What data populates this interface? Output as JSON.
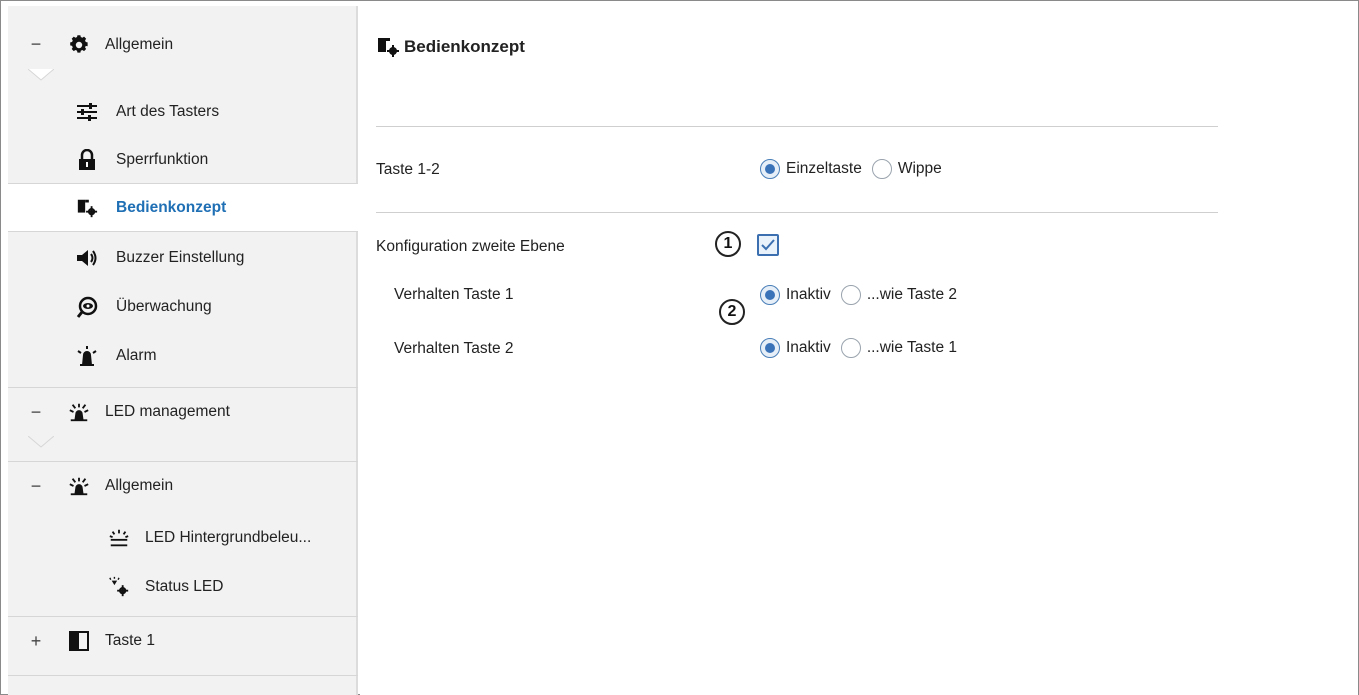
{
  "sidebar": {
    "general": {
      "label": "Allgemein",
      "toggle": "−",
      "icon": "gear-icon"
    },
    "items": [
      {
        "label": "Art des Tasters",
        "icon": "sliders-icon"
      },
      {
        "label": "Sperrfunktion",
        "icon": "lock-icon"
      },
      {
        "label": "Bedienkonzept",
        "icon": "panel-gear-icon",
        "active": true
      },
      {
        "label": "Buzzer Einstellung",
        "icon": "speaker-icon"
      },
      {
        "label": "Überwachung",
        "icon": "eye-monitor-icon"
      },
      {
        "label": "Alarm",
        "icon": "alarm-icon"
      }
    ],
    "led_management": {
      "label": "LED management",
      "toggle": "−",
      "icon": "led-icon"
    },
    "led_general": {
      "label": "Allgemein",
      "toggle": "−",
      "icon": "led-icon"
    },
    "led_items": [
      {
        "label": "LED Hintergrundbeleu...",
        "icon": "backlight-icon"
      },
      {
        "label": "Status LED",
        "icon": "status-led-icon"
      }
    ],
    "taste1": {
      "label": "Taste 1",
      "toggle": "+",
      "icon": "button-panel-icon"
    }
  },
  "main": {
    "title": "Bedienkonzept",
    "rows": {
      "taste12": {
        "label": "Taste 1-2",
        "options": [
          "Einzeltaste",
          "Wippe"
        ],
        "selected": "Einzeltaste"
      },
      "second_level": {
        "label": "Konfiguration zweite Ebene",
        "checked": true
      },
      "verhalten1": {
        "label": "Verhalten Taste 1",
        "options": [
          "Inaktiv",
          "...wie Taste 2"
        ],
        "selected": "Inaktiv"
      },
      "verhalten2": {
        "label": "Verhalten Taste 2",
        "options": [
          "Inaktiv",
          "...wie Taste 1"
        ],
        "selected": "Inaktiv"
      }
    },
    "callouts": [
      "1",
      "2"
    ]
  },
  "colors": {
    "accent": "#1f6fb5",
    "radio_dot": "#3b73b9",
    "sidebar_bg": "#f2f2f2"
  }
}
